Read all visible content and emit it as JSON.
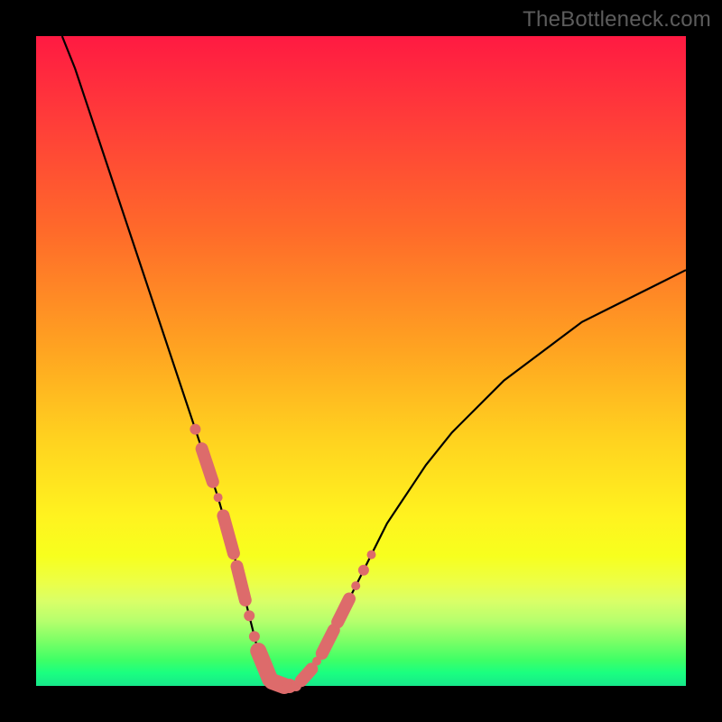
{
  "attribution": "TheBottleneck.com",
  "colors": {
    "bg": "#000000",
    "gradient_top": "#ff1a42",
    "gradient_bottom": "#17e88a",
    "curve": "#000000",
    "bead": "#dd6b6b",
    "attribution_text": "#5c5c5c"
  },
  "chart_data": {
    "type": "line",
    "title": "",
    "xlabel": "",
    "ylabel": "",
    "xlim": [
      0,
      100
    ],
    "ylim": [
      0,
      100
    ],
    "grid": false,
    "legend": false,
    "series": [
      {
        "name": "bottleneck-curve",
        "x": [
          4,
          6,
          8,
          10,
          12,
          14,
          16,
          18,
          20,
          22,
          24,
          26,
          28,
          30,
          31,
          32,
          33,
          34,
          35,
          36,
          37,
          38,
          40,
          42,
          44,
          46,
          48,
          50,
          52,
          54,
          56,
          58,
          60,
          64,
          68,
          72,
          76,
          80,
          84,
          88,
          92,
          96,
          100
        ],
        "y": [
          100,
          95,
          89,
          83,
          77,
          71,
          65,
          59,
          53,
          47,
          41,
          35,
          29,
          22,
          18,
          14,
          10,
          6,
          3,
          1,
          0,
          0,
          0,
          2,
          5,
          9,
          13,
          17,
          21,
          25,
          28,
          31,
          34,
          39,
          43,
          47,
          50,
          53,
          56,
          58,
          60,
          62,
          64
        ]
      }
    ],
    "annotations": [
      {
        "name": "bead-cluster-left",
        "description": "String of salmon-colored beads along the lower-left descending arm of the curve",
        "approx_x_range": [
          24,
          34
        ],
        "approx_y_range": [
          3,
          35
        ]
      },
      {
        "name": "bead-cluster-right",
        "description": "String of salmon-colored beads along the lower-right ascending arm of the curve",
        "approx_x_range": [
          38,
          52
        ],
        "approx_y_range": [
          0,
          23
        ]
      },
      {
        "name": "trough-beads",
        "description": "Larger beads forming a short horizontal run at the curve minimum",
        "approx_x_range": [
          33,
          40
        ],
        "approx_y_range": [
          0,
          2
        ]
      }
    ]
  }
}
